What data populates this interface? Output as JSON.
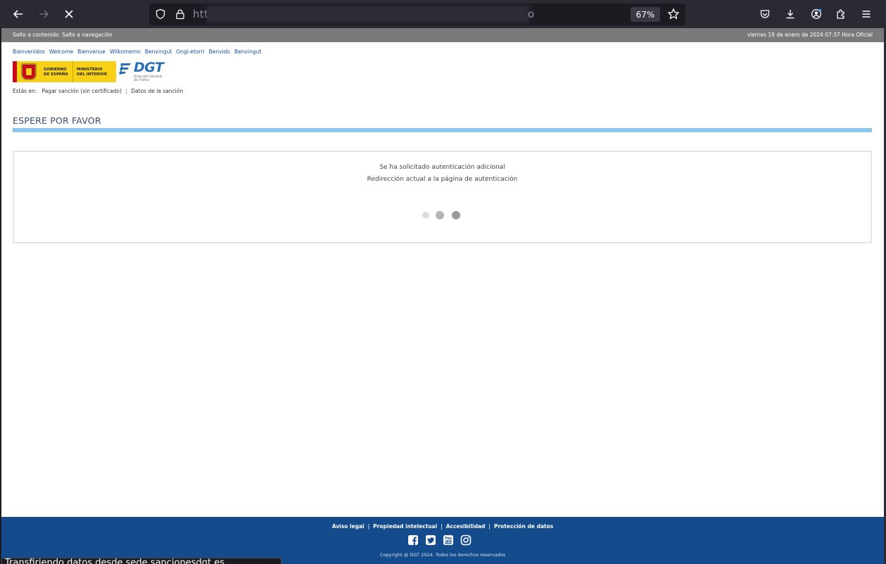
{
  "browser": {
    "url_start": "htt",
    "url_end": "o",
    "zoom": "67%"
  },
  "topbar": {
    "skip_content": "Salto a contenido",
    "skip_nav": "Salto a navegación",
    "date": "viernes 19 de enero de 2024 07:37 Hora Oficial"
  },
  "languages": [
    "Bienvenidos",
    "Welcome",
    "Bienvenue",
    "Wilkomemn",
    "Benvingut",
    "Ongi-etorri",
    "Benvido",
    "Benvingut"
  ],
  "logos": {
    "gobierno": [
      "GOBIERNO",
      "DE ESPAÑA"
    ],
    "ministerio": [
      "MINISTERIO",
      "DEL INTERIOR"
    ],
    "dgt": "DGT",
    "dgt_sub": [
      "Dirección General",
      "de Tráfico"
    ]
  },
  "breadcrumb": {
    "label": "Estás en:",
    "items": [
      "Pagar sanción (sin certificado)",
      "Datos de la sanción"
    ]
  },
  "main": {
    "heading": "ESPERE POR FAVOR",
    "message_1": "Se ha solicitado autenticación adicional",
    "message_2": "Redirección actual a la página de autenticación"
  },
  "footer": {
    "links": [
      "Aviso legal",
      "Propiedad intelectual",
      "Accesibilidad",
      "Protección de datos"
    ],
    "social": [
      "facebook-icon",
      "twitter-icon",
      "youtube-icon",
      "instagram-icon"
    ],
    "copyright": "Copyright @ DGT 2024. Todos los derechos reservados"
  },
  "status": {
    "text": "Transfiriendo datos desde sede.sancionesdgt.es..."
  },
  "colors": {
    "accent_bar": "#8dc6ec",
    "footer": "#144b8c",
    "topbar": "#7a7a7a"
  }
}
